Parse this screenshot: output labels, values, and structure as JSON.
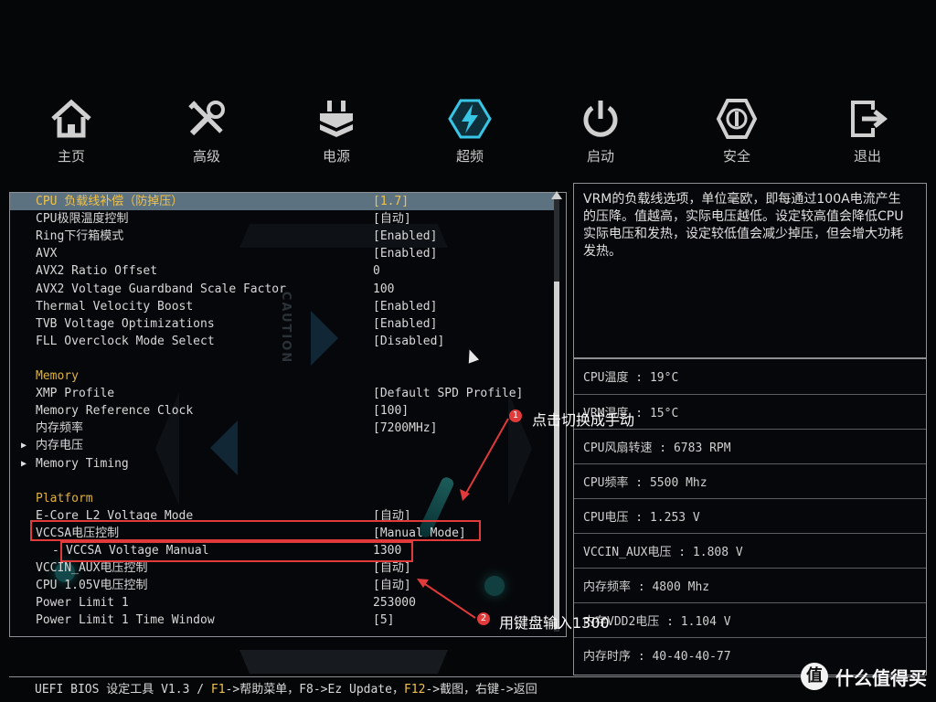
{
  "nav": [
    {
      "label": "主页",
      "icon": "home-icon"
    },
    {
      "label": "高级",
      "icon": "tools-icon"
    },
    {
      "label": "电源",
      "icon": "power-plug-icon"
    },
    {
      "label": "超频",
      "icon": "overclock-bolt-icon"
    },
    {
      "label": "启动",
      "icon": "power-button-icon"
    },
    {
      "label": "安全",
      "icon": "security-icon"
    },
    {
      "label": "退出",
      "icon": "exit-icon"
    }
  ],
  "active_nav": "超频",
  "settings": [
    {
      "label": "CPU 负载线补偿（防掉压）",
      "value": "[1.7]",
      "selected": true
    },
    {
      "label": "CPU极限温度控制",
      "value": "[自动]"
    },
    {
      "label": "Ring下行箱模式",
      "value": "[Enabled]"
    },
    {
      "label": "AVX",
      "value": "[Enabled]"
    },
    {
      "label": "AVX2 Ratio Offset",
      "value": "0"
    },
    {
      "label": "AVX2 Voltage Guardband Scale Factor",
      "value": "100"
    },
    {
      "label": "Thermal Velocity Boost",
      "value": "[Enabled]"
    },
    {
      "label": "TVB Voltage Optimizations",
      "value": "[Enabled]"
    },
    {
      "label": "FLL Overclock Mode Select",
      "value": "[Disabled]"
    },
    {
      "label": "",
      "value": ""
    },
    {
      "label": "Memory",
      "value": "",
      "section": true
    },
    {
      "label": "XMP Profile",
      "value": "[Default SPD Profile]"
    },
    {
      "label": "Memory Reference Clock",
      "value": "[100]"
    },
    {
      "label": "内存频率",
      "value": "[7200MHz]"
    },
    {
      "label": "内存电压",
      "value": "",
      "submenu": true
    },
    {
      "label": "Memory Timing",
      "value": "",
      "submenu": true
    },
    {
      "label": "",
      "value": ""
    },
    {
      "label": "Platform",
      "value": "",
      "section": true
    },
    {
      "label": "E-Core L2 Voltage Mode",
      "value": "[自动]"
    },
    {
      "label": "VCCSA电压控制",
      "value": "[Manual Mode]"
    },
    {
      "label": "VCCSA Voltage Manual",
      "value": "1300",
      "sub": true
    },
    {
      "label": "VCCIN_AUX电压控制",
      "value": "[自动]"
    },
    {
      "label": "CPU 1.05V电压控制",
      "value": "[自动]"
    },
    {
      "label": "Power Limit 1",
      "value": "253000"
    },
    {
      "label": "Power Limit 1 Time Window",
      "value": "[5]"
    }
  ],
  "help_text": "VRM的负载线选项，单位毫欧，即每通过100A电流产生的压降。值越高，实际电压越低。设定较高值会降低CPU实际电压和发热，设定较低值会减少掉压，但会增大功耗发热。",
  "info": [
    "CPU温度 : 19°C",
    "VRM温度 : 15°C",
    "CPU风扇转速 : 6783 RPM",
    "CPU频率 : 5500 Mhz",
    "CPU电压 : 1.253 V",
    "VCCIN_AUX电压 : 1.808 V",
    "内存频率 : 4800 Mhz",
    "内存VDD2电压 : 1.104 V",
    "内存时序 : 40-40-40-77"
  ],
  "status": {
    "prefix": "UEFI BIOS 设定工具 V1.3 / ",
    "f1": "F1",
    "f1_text": "->帮助菜单，F8->Ez Update，",
    "f12": "F12",
    "f12_text": "->截图，右键->返回"
  },
  "annotations": {
    "note1_num": "1",
    "note1": "点击切换成手动",
    "note2_num": "2",
    "note2": "用键盘输入1300"
  },
  "watermark": {
    "logo": "值",
    "text": "什么值得买"
  },
  "colors": {
    "highlight_row": "#5c7280",
    "selected_text": "#f0c24a",
    "section_text": "#e0b13f",
    "annotation": "#e03a3a",
    "accent_cyan": "#2fd5d0"
  }
}
